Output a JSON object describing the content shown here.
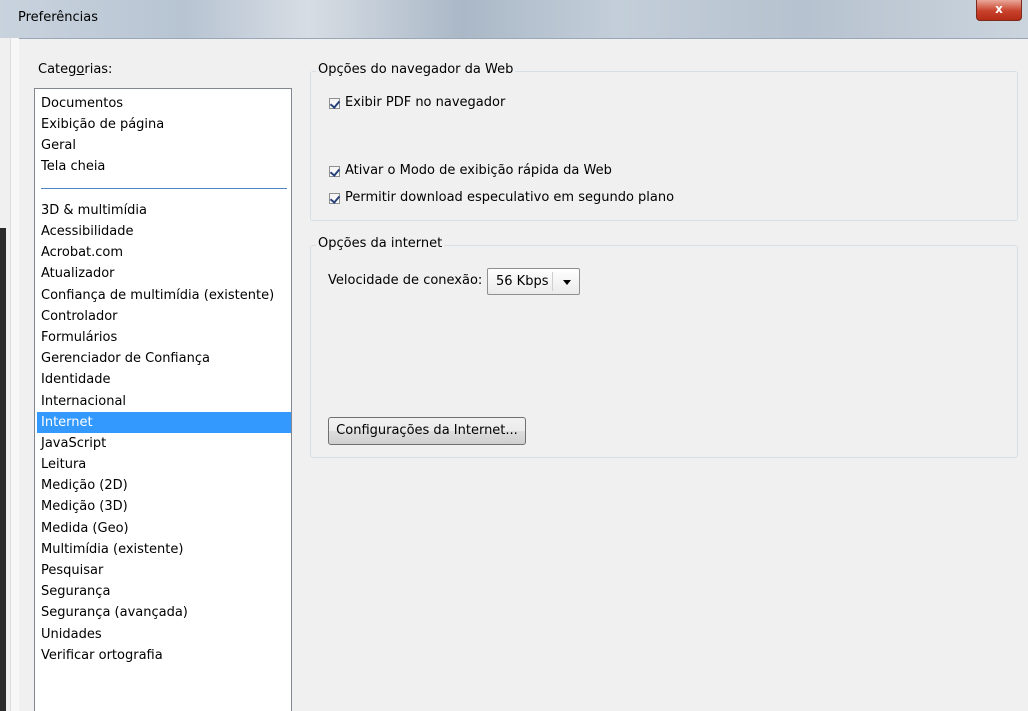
{
  "window": {
    "title": "Preferências",
    "close_label": "x"
  },
  "categories": {
    "label": "Categorias:",
    "items_top": [
      "Documentos",
      "Exibição de página",
      "Geral",
      "Tela cheia"
    ],
    "items": [
      "3D & multimídia",
      "Acessibilidade",
      "Acrobat.com",
      "Atualizador",
      "Confiança de multimídia (existente)",
      "Controlador",
      "Formulários",
      "Gerenciador de Confiança",
      "Identidade",
      "Internacional",
      "Internet",
      "JavaScript",
      "Leitura",
      "Medição (2D)",
      "Medição (3D)",
      "Medida (Geo)",
      "Multimídia (existente)",
      "Pesquisar",
      "Segurança",
      "Segurança (avançada)",
      "Unidades",
      "Verificar ortografia"
    ],
    "selected": "Internet"
  },
  "browser_group": {
    "title": "Opções do navegador da Web",
    "options": [
      {
        "label": "Exibir PDF no navegador",
        "checked": true
      },
      {
        "label": "Ativar o Modo de exibição rápida da Web",
        "checked": true
      },
      {
        "label": "Permitir download especulativo em segundo plano",
        "checked": true
      }
    ]
  },
  "internet_group": {
    "title": "Opções da internet",
    "speed_label": "Velocidade de conexão:",
    "speed_value": "56 Kbps",
    "settings_button": "Configurações da Internet..."
  }
}
